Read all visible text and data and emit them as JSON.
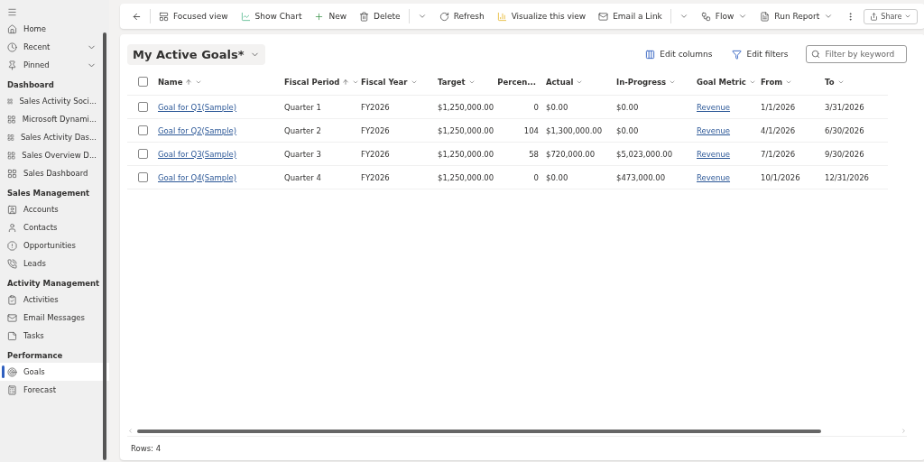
{
  "sidebar": {
    "top_items": [
      {
        "label": "Home",
        "expandable": false
      },
      {
        "label": "Recent",
        "expandable": true
      },
      {
        "label": "Pinned",
        "expandable": true
      }
    ],
    "sections": [
      {
        "title": "Dashboard",
        "items": [
          {
            "label": "Sales Activity Soci...",
            "selected": false
          },
          {
            "label": "Microsoft Dynami...",
            "selected": false
          },
          {
            "label": "Sales Activity Das...",
            "selected": false
          },
          {
            "label": "Sales Overview D...",
            "selected": false
          },
          {
            "label": "Sales Dashboard",
            "selected": false
          }
        ]
      },
      {
        "title": "Sales Management",
        "items": [
          {
            "label": "Accounts",
            "selected": false
          },
          {
            "label": "Contacts",
            "selected": false
          },
          {
            "label": "Opportunities",
            "selected": false
          },
          {
            "label": "Leads",
            "selected": false
          }
        ]
      },
      {
        "title": "Activity Management",
        "items": [
          {
            "label": "Activities",
            "selected": false
          },
          {
            "label": "Email Messages",
            "selected": false
          },
          {
            "label": "Tasks",
            "selected": false
          }
        ]
      },
      {
        "title": "Performance",
        "items": [
          {
            "label": "Goals",
            "selected": true
          },
          {
            "label": "Forecast",
            "selected": false
          }
        ]
      }
    ]
  },
  "toolbar": {
    "items": [
      {
        "kind": "button",
        "label": "Focused view"
      },
      {
        "kind": "button",
        "label": "Show Chart"
      },
      {
        "kind": "button",
        "label": "New"
      },
      {
        "kind": "button",
        "label": "Delete"
      },
      {
        "kind": "dropdown"
      },
      {
        "kind": "button",
        "label": "Refresh"
      },
      {
        "kind": "button",
        "label": "Visualize this view"
      },
      {
        "kind": "button",
        "label": "Email a Link"
      },
      {
        "kind": "dropdown"
      },
      {
        "kind": "split",
        "label": "Flow"
      },
      {
        "kind": "split",
        "label": "Run Report"
      },
      {
        "kind": "more"
      }
    ],
    "share": "Share"
  },
  "view": {
    "title": "My Active Goals*",
    "edit_columns": "Edit columns",
    "edit_filters": "Edit filters",
    "search": {
      "placeholder": "Filter by keyword"
    }
  },
  "table": {
    "select_all_checked": false,
    "columns": [
      {
        "label": "Name",
        "sorted": true
      },
      {
        "label": "Fiscal Period",
        "sorted": true
      },
      {
        "label": "Fiscal Year",
        "sorted": false
      },
      {
        "label": "Target",
        "sorted": false
      },
      {
        "label": "Percen...",
        "sorted": false
      },
      {
        "label": "Actual",
        "sorted": false
      },
      {
        "label": "In-Progress",
        "sorted": false
      },
      {
        "label": "Goal Metric",
        "sorted": false
      },
      {
        "label": "From",
        "sorted": false
      },
      {
        "label": "To",
        "sorted": false
      }
    ],
    "rows": [
      {
        "checked": false,
        "cells": [
          "Goal for Q1(Sample)",
          "Quarter 1",
          "FY2026",
          "$1,250,000.00",
          "0",
          "$0.00",
          "$0.00",
          "Revenue",
          "1/1/2026",
          "3/31/2026"
        ]
      },
      {
        "checked": false,
        "cells": [
          "Goal for Q2(Sample)",
          "Quarter 2",
          "FY2026",
          "$1,250,000.00",
          "104",
          "$1,300,000.00",
          "$0.00",
          "Revenue",
          "4/1/2026",
          "6/30/2026"
        ]
      },
      {
        "checked": false,
        "cells": [
          "Goal for Q3(Sample)",
          "Quarter 3",
          "FY2026",
          "$1,250,000.00",
          "58",
          "$720,000.00",
          "$5,023,000.00",
          "Revenue",
          "7/1/2026",
          "9/30/2026"
        ]
      },
      {
        "checked": false,
        "cells": [
          "Goal for Q4(Sample)",
          "Quarter 4",
          "FY2026",
          "$1,250,000.00",
          "0",
          "$0.00",
          "$473,000.00",
          "Revenue",
          "10/1/2026",
          "12/31/2026"
        ]
      }
    ]
  },
  "status_bar": {
    "rows": "Rows: 4"
  }
}
